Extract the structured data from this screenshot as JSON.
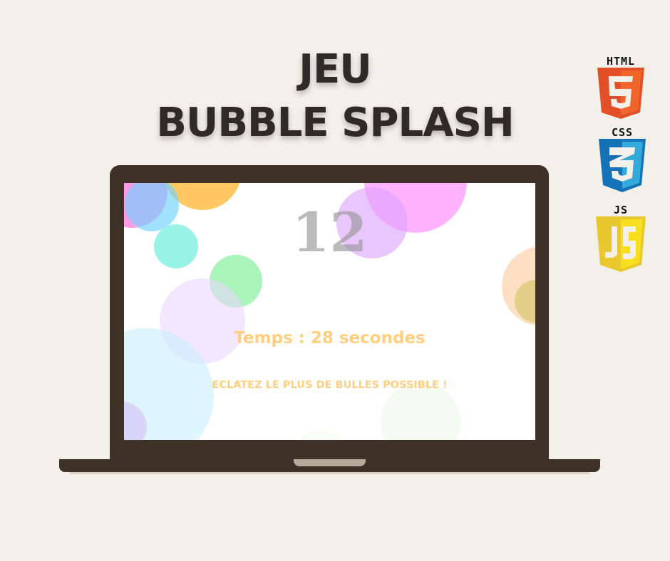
{
  "title": {
    "line1": "JEU",
    "line2": "BUBBLE SPLASH"
  },
  "game": {
    "count": "12",
    "timer": "Temps : 28 secondes",
    "instruction": "ECLATEZ LE PLUS DE BULLES POSSIBLE !"
  },
  "logos": [
    {
      "label": "HTML",
      "glyph": "5",
      "colors": [
        "#e34f26",
        "#f06529"
      ]
    },
    {
      "label": "CSS",
      "glyph": "3",
      "colors": [
        "#1572b6",
        "#33a9dc"
      ]
    },
    {
      "label": "JS",
      "glyph": "JS",
      "colors": [
        "#e8c82e",
        "#f7df1e"
      ]
    }
  ],
  "bubble_colors": [
    "#ff8ee0",
    "#ffc75f",
    "#8fdcff",
    "#99f2e6",
    "#a8f5bb",
    "#f3e4ff",
    "#dff6fd",
    "#e0d6f6",
    "#ffb3fd",
    "#e9c2ff",
    "#fde0c4",
    "#e5d38c",
    "#f4fbf0"
  ]
}
